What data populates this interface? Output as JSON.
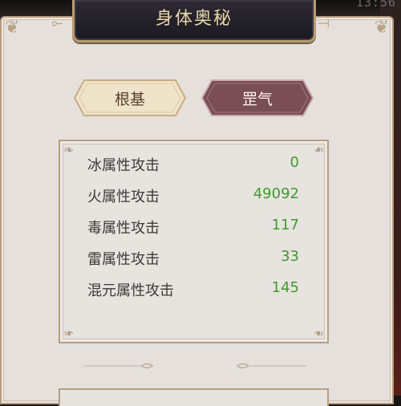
{
  "status_bar": {
    "clock": "13:56"
  },
  "window": {
    "title": "身体奥秘"
  },
  "tabs": [
    {
      "label": "根基",
      "active": false
    },
    {
      "label": "罡气",
      "active": true
    }
  ],
  "stats": [
    {
      "label": "冰属性攻击",
      "value": "0"
    },
    {
      "label": "火属性攻击",
      "value": "49092"
    },
    {
      "label": "毒属性攻击",
      "value": "117"
    },
    {
      "label": "雷属性攻击",
      "value": "33"
    },
    {
      "label": "混元属性攻击",
      "value": "145"
    }
  ],
  "colors": {
    "panel": "#e5e0db",
    "title_text": "#e9d7a9",
    "value_green": "#3f9a2f",
    "active_tab": "#7a4e55",
    "inactive_tab": "#efe3c9"
  }
}
